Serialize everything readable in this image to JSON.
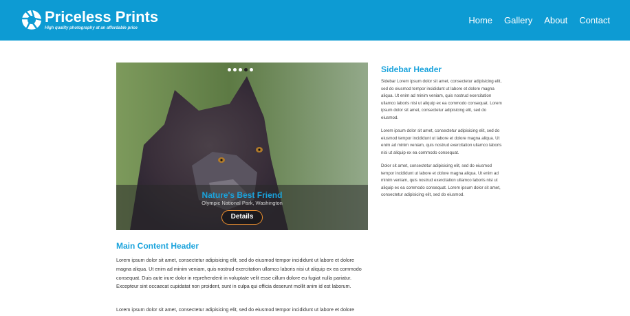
{
  "brand": {
    "title": "Priceless Prints",
    "tagline": "High quality photography at an affordable price",
    "logo_icon": "aperture-icon",
    "color": "#0d9bd3"
  },
  "nav": {
    "items": [
      {
        "label": "Home"
      },
      {
        "label": "Gallery"
      },
      {
        "label": "About"
      },
      {
        "label": "Contact"
      }
    ]
  },
  "slider": {
    "active_index": 4,
    "slide_count": 5,
    "caption_title": "Nature's Best Friend",
    "caption_subtitle": "Olympic National Park, Washington",
    "button_label": "Details",
    "button_color": "#f0912f"
  },
  "main": {
    "header": "Main Content Header",
    "paragraphs": [
      "Lorem ipsum dolor sit amet, consectetur adipisicing elit, sed do eiusmod tempor incididunt ut labore et dolore magna aliqua. Ut enim ad minim veniam, quis nostrud exercitation ullamco laboris nisi ut aliquip ex ea commodo consequat. Duis aute irure dolor in reprehenderit in voluptate velit esse cillum dolore eu fugiat nulla pariatur. Excepteur sint occaecat cupidatat non proident, sunt in culpa qui officia deserunt mollit anim id est laborum.",
      "Lorem ipsum dolor sit amet, consectetur adipisicing elit, sed do eiusmod tempor incididunt ut labore et dolore"
    ]
  },
  "sidebar": {
    "header": "Sidebar Header",
    "paragraphs": [
      "Sidebar Lorem ipsum dolor sit amet, consectetur adipisicing elit, sed do eiusmod tempor incididunt ut labore et dolore magna aliqua. Ut enim ad minim veniam, quis nostrud exercitation ullamco laboris nisi ut aliquip ex ea commodo consequat. Lorem ipsum dolor sit amet, consectetur adipisicing elit, sed do eiusmod.",
      "Lorem ipsum dolor sit amet, consectetur adipisicing elit, sed do eiusmod tempor incididunt ut labore et dolore magna aliqua. Ut enim ad minim veniam, quis nostrud exercitation ullamco laboris nisi ut aliquip ex ea commodo consequat.",
      "Dolor sit amet, consectetur adipisicing elit, sed do eiusmod tempor incididunt ut labore et dolore magna aliqua. Ut enim ad minim veniam, quis nostrud exercitation ullamco laboris nisi ut aliquip ex ea commodo consequat. Lorem ipsum dolor sit amet, consectetur adipisicing elit, sed do eiusmod."
    ]
  },
  "colors": {
    "accent": "#1aa3dc",
    "text": "#333333"
  }
}
